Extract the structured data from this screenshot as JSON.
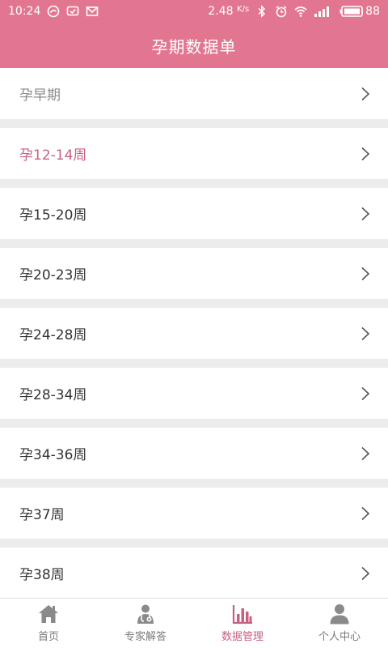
{
  "status_bar": {
    "time": "10:24",
    "speed": "2.48",
    "speed_unit": "K/s",
    "battery": "88",
    "icons": [
      "notification-app-icon",
      "notification-message-icon",
      "notification-mail-icon",
      "bluetooth-icon",
      "alarm-icon",
      "wifi-icon",
      "signal-icon",
      "battery-icon"
    ]
  },
  "header": {
    "title": "孕期数据单"
  },
  "list": {
    "items": [
      {
        "label": "孕早期",
        "state": "dim"
      },
      {
        "label": "孕12-14周",
        "state": "active"
      },
      {
        "label": "孕15-20周",
        "state": "normal"
      },
      {
        "label": "孕20-23周",
        "state": "normal"
      },
      {
        "label": "孕24-28周",
        "state": "normal"
      },
      {
        "label": "孕28-34周",
        "state": "normal"
      },
      {
        "label": "孕34-36周",
        "state": "normal"
      },
      {
        "label": "孕37周",
        "state": "normal"
      },
      {
        "label": "孕38周",
        "state": "normal"
      }
    ],
    "chevron_icon": "chevron-right-icon"
  },
  "bottom_nav": {
    "items": [
      {
        "label": "首页",
        "icon": "home-icon"
      },
      {
        "label": "专家解答",
        "icon": "doctor-icon"
      },
      {
        "label": "数据管理",
        "icon": "bar-chart-icon",
        "active": true
      },
      {
        "label": "个人中心",
        "icon": "user-icon"
      }
    ]
  },
  "colors": {
    "primary": "#e27691",
    "active_text": "#c8607f",
    "background": "#ececec",
    "icon_gray": "#7a7a7a"
  }
}
